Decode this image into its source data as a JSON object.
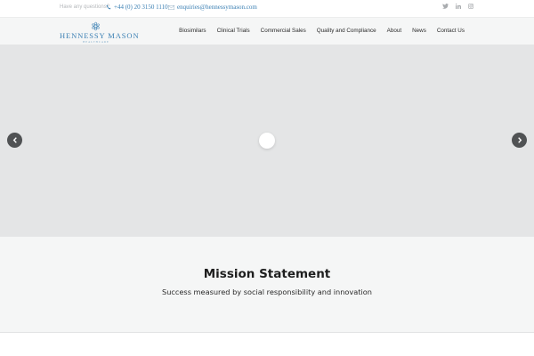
{
  "topbar": {
    "question": "Have any questions?",
    "phone": "+44 (0) 20 3150 1110",
    "email": "enquiries@hennessymason.com",
    "social_icons": [
      "twitter-icon",
      "linkedin-icon",
      "instagram-icon"
    ]
  },
  "logo": {
    "name": "HENNESSY MASON",
    "sub": "HEALTHCARE"
  },
  "nav": {
    "items": [
      "Biosimilars",
      "Clinical Trials",
      "Commercial Sales",
      "Quality and Compliance",
      "About",
      "News",
      "Contact Us"
    ]
  },
  "slider": {
    "prev_icon": "chevron-left-icon",
    "next_icon": "chevron-right-icon"
  },
  "mission": {
    "title": "Mission Statement",
    "subtitle": "Success measured by social responsibility and innovation"
  },
  "colors": {
    "brand": "#3a7fb3",
    "slider_bg": "#e4e5e6",
    "section_bg": "#f5f6f6",
    "arrow_bg": "#505254"
  }
}
